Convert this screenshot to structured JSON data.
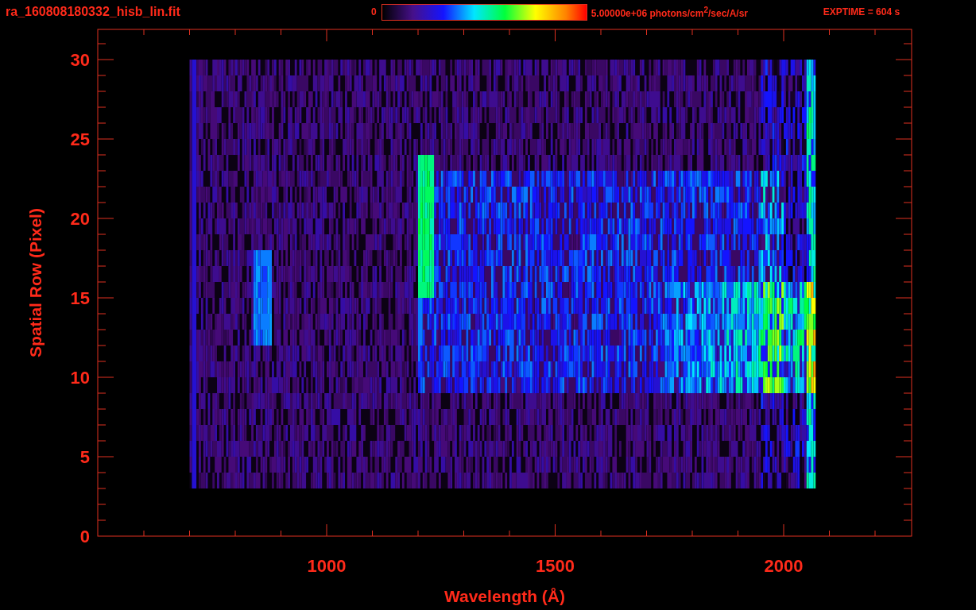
{
  "header": {
    "filename": "ra_160808180332_hisb_lin.fit",
    "colorbar_min": "0",
    "colorbar_max": "5.00000e+06 photons/cm$^{2}$/sec/A/sr",
    "exposure": "EXPTIME = 604 s"
  },
  "plot": {
    "ylabel": "Spatial Row (Pixel)",
    "xlabel": "Wavelength (Å)",
    "yticks": [
      "30",
      "25",
      "20",
      "15",
      "10",
      "5",
      "0"
    ],
    "xticks": [
      "1000",
      "1500",
      "2000"
    ]
  }
}
